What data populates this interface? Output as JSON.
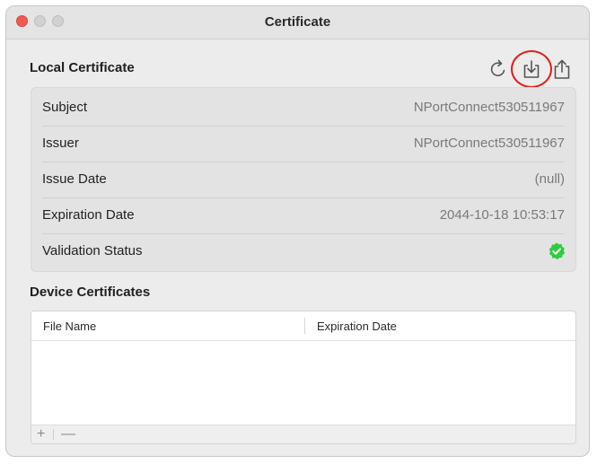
{
  "window": {
    "title": "Certificate"
  },
  "local_certificate": {
    "heading": "Local Certificate",
    "rows": [
      {
        "label": "Subject",
        "value": "NPortConnect530511967"
      },
      {
        "label": "Issuer",
        "value": "NPortConnect530511967"
      },
      {
        "label": "Issue Date",
        "value": "(null)"
      },
      {
        "label": "Expiration Date",
        "value": "2044-10-18 10:53:17"
      },
      {
        "label": "Validation Status",
        "value": ""
      }
    ],
    "validation_icon": "green-check-badge-icon",
    "toolbar_icons": [
      "refresh-icon",
      "download-icon",
      "share-icon"
    ]
  },
  "device_certificates": {
    "heading": "Device Certificates",
    "columns": [
      "File Name",
      "Expiration Date"
    ],
    "rows": [],
    "add_label": "+",
    "remove_label": "—"
  },
  "colors": {
    "highlight": "#e0201b",
    "valid": "#2ecc40"
  }
}
